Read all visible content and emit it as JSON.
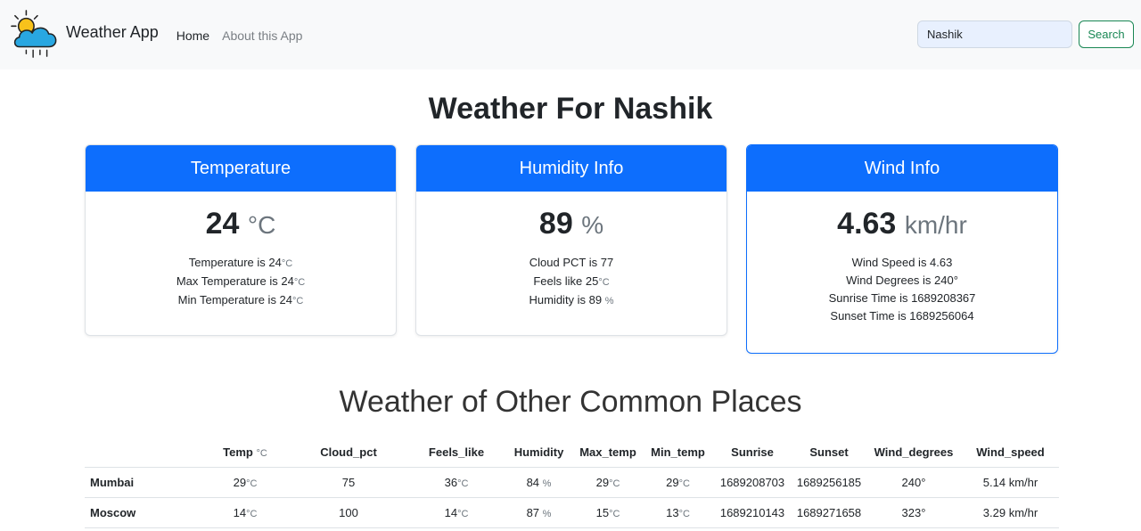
{
  "navbar": {
    "brand": "Weather App",
    "links": [
      {
        "label": "Home"
      },
      {
        "label": "About this App"
      }
    ],
    "search": {
      "value": "Nashik",
      "button": "Search"
    }
  },
  "main": {
    "title": "Weather For Nashik",
    "cards": {
      "temperature": {
        "header": "Temperature",
        "value": "24",
        "unit": "°C",
        "lines": [
          {
            "text": "Temperature is 24",
            "unit": "°C"
          },
          {
            "text": "Max Temperature is 24",
            "unit": "°C"
          },
          {
            "text": "Min Temperature is 24",
            "unit": "°C"
          }
        ]
      },
      "humidity": {
        "header": "Humidity Info",
        "value": "89",
        "unit": "%",
        "lines": [
          {
            "text": "Cloud PCT is 77",
            "unit": ""
          },
          {
            "text": "Feels like 25",
            "unit": "°C"
          },
          {
            "text": "Humidity is 89 ",
            "unit": "%"
          }
        ]
      },
      "wind": {
        "header": "Wind Info",
        "value": "4.63",
        "unit": "km/hr",
        "lines": [
          {
            "text": "Wind Speed is 4.63"
          },
          {
            "text": "Wind Degrees is 240°"
          },
          {
            "text": "Sunrise Time is 1689208367"
          },
          {
            "text": "Sunset Time is 1689256064"
          }
        ]
      }
    }
  },
  "others": {
    "title": "Weather of Other Common Places",
    "headers": [
      "",
      "Temp",
      "Cloud_pct",
      "Feels_like",
      "Humidity",
      "Max_temp",
      "Min_temp",
      "Sunrise",
      "Sunset",
      "Wind_degrees",
      "Wind_speed"
    ],
    "temp_header_unit": "°C",
    "rows": [
      {
        "city": "Mumbai",
        "temp": "29",
        "temp_unit": "°C",
        "cloud_pct": "75",
        "feels_like": "36",
        "feels_unit": "°C",
        "humidity": "84 ",
        "humidity_unit": "%",
        "max_temp": "29",
        "max_unit": "°C",
        "min_temp": "29",
        "min_unit": "°C",
        "sunrise": "1689208703",
        "sunset": "1689256185",
        "wind_degrees": "240°",
        "wind_speed": "5.14 km/hr"
      },
      {
        "city": "Moscow",
        "temp": "14",
        "temp_unit": "°C",
        "cloud_pct": "100",
        "feels_like": "14",
        "feels_unit": "°C",
        "humidity": "87 ",
        "humidity_unit": "%",
        "max_temp": "15",
        "max_unit": "°C",
        "min_temp": "13",
        "min_unit": "°C",
        "sunrise": "1689210143",
        "sunset": "1689271658",
        "wind_degrees": "323°",
        "wind_speed": "3.29 km/hr"
      }
    ]
  },
  "colors": {
    "primary": "#0d6efd",
    "success": "#198754",
    "navbar_bg": "#f8f9fa"
  },
  "icons": {
    "brand_logo": "sun-cloud-rain-icon"
  }
}
